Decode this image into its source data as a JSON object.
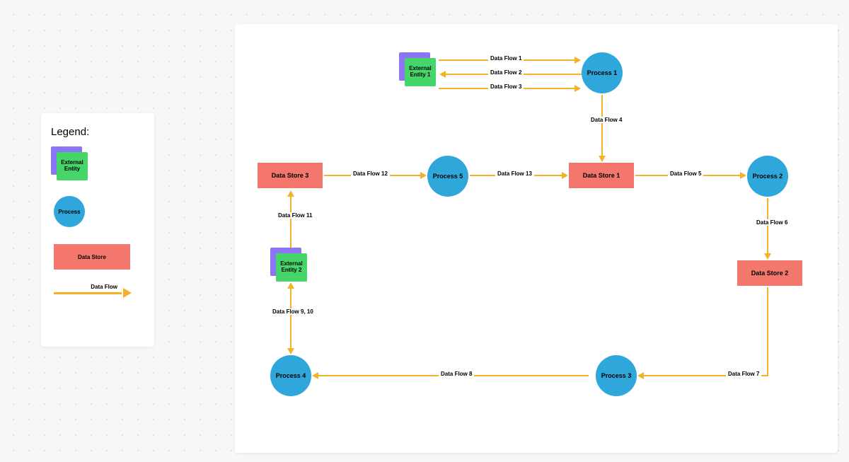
{
  "legend": {
    "title": "Legend:",
    "external_entity": "External\nEntity",
    "process": "Process",
    "data_store": "Data Store",
    "data_flow": "Data Flow"
  },
  "nodes": {
    "ext1": "External\nEntity 1",
    "ext2": "External\nEntity 2",
    "p1": "Process 1",
    "p2": "Process 2",
    "p3": "Process 3",
    "p4": "Process 4",
    "p5": "Process 5",
    "ds1": "Data Store 1",
    "ds2": "Data Store 2",
    "ds3": "Data Store 3"
  },
  "flows": {
    "f1": "Data Flow 1",
    "f2": "Data Flow 2",
    "f3": "Data Flow 3",
    "f4": "Data Flow 4",
    "f5": "Data Flow 5",
    "f6": "Data Flow 6",
    "f7": "Data Flow 7",
    "f8": "Data Flow 8",
    "f9_10": "Data Flow 9, 10",
    "f11": "Data Flow 11",
    "f12": "Data Flow 12",
    "f13": "Data Flow 13"
  }
}
